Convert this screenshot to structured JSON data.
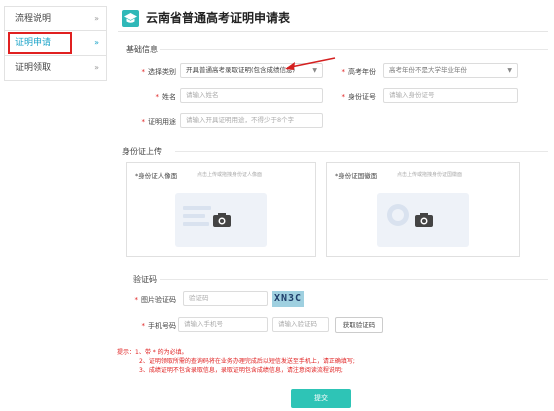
{
  "sidebar": {
    "items": [
      {
        "label": "流程说明",
        "chev": "»"
      },
      {
        "label": "证明申请",
        "chev": "»"
      },
      {
        "label": "证明领取",
        "chev": "»"
      }
    ]
  },
  "page": {
    "title": "云南省普通高考证明申请表"
  },
  "basic": {
    "section": "基础信息",
    "type_label": "选择类别",
    "type_value": "开具普通高考录取证明(包含成绩信息)",
    "year_label": "高考年份",
    "year_value": "高考年份不是大学毕业年份",
    "name_label": "姓名",
    "name_placeholder": "请输入姓名",
    "id_label": "身份证号",
    "id_placeholder": "请输入身份证号",
    "purpose_label": "证明用途",
    "purpose_placeholder": "请输入开具证明用途，不得少于8个字"
  },
  "upload": {
    "section": "身份证上传",
    "front_label": "*身份证人像面",
    "front_hint": "点击上传或拖拽身份证人像面",
    "back_label": "*身份证国徽面",
    "back_hint": "点击上传或拖拽身份证国徽面"
  },
  "verify": {
    "section": "验证码",
    "img_label": "图片验证码",
    "img_placeholder": "验证码",
    "captcha_text": "XN3C",
    "phone_label": "手机号码",
    "phone_placeholder": "请输入手机号",
    "sms_placeholder": "请输入验证码",
    "get_code": "获取验证码"
  },
  "tips": {
    "line1": "提示：1、带 * 的为必填。",
    "line2": "2、证明领取所需的查询码将在业务办理完成后以短信发送至手机上，请正确填写;",
    "line3": "3、成绩证明不包含录取信息，录取证明包含成绩信息，请注意阅读流程说明;"
  },
  "submit": "提交",
  "colors": {
    "accent": "#2ec4b6",
    "required": "#e02020",
    "highlight_box": "#e02020"
  }
}
